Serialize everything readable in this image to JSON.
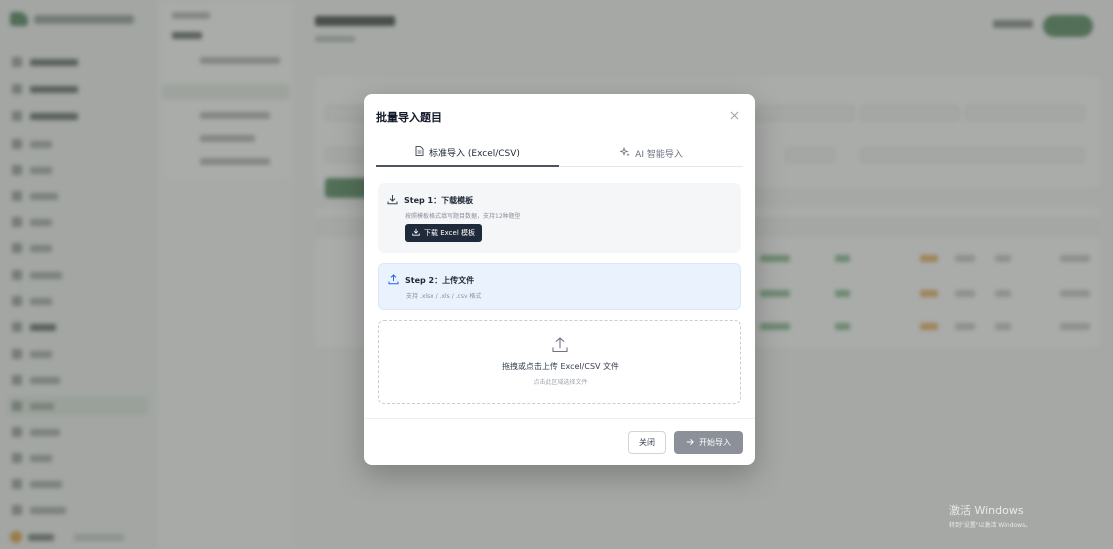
{
  "modal": {
    "title": "批量导入题目",
    "tabs": [
      {
        "label": "标准导入 (Excel/CSV)",
        "icon": "file-icon",
        "active": true
      },
      {
        "label": "AI 智能导入",
        "icon": "sparkle-icon",
        "active": false
      }
    ],
    "step1": {
      "title": "Step 1：下载模板",
      "description": "按照模板格式填写题目数据，支持12种题型",
      "button": "下载 Excel 模板"
    },
    "step2": {
      "title": "Step 2：上传文件",
      "description": "支持 .xlsx / .xls / .csv 格式"
    },
    "dropzone": {
      "main": "拖拽或点击上传 Excel/CSV 文件",
      "hint": "点击此区域选择文件"
    },
    "footer": {
      "cancel": "关闭",
      "submit": "开始导入"
    }
  },
  "watermark": {
    "line1": "激活 Windows",
    "line2": "转到\"设置\"以激活 Windows。"
  },
  "colors": {
    "primary_dark": "#1f2a3a",
    "step2_bg": "#eaf2fd",
    "submit_disabled": "#8b9099",
    "brand_green": "#5d8d65"
  }
}
